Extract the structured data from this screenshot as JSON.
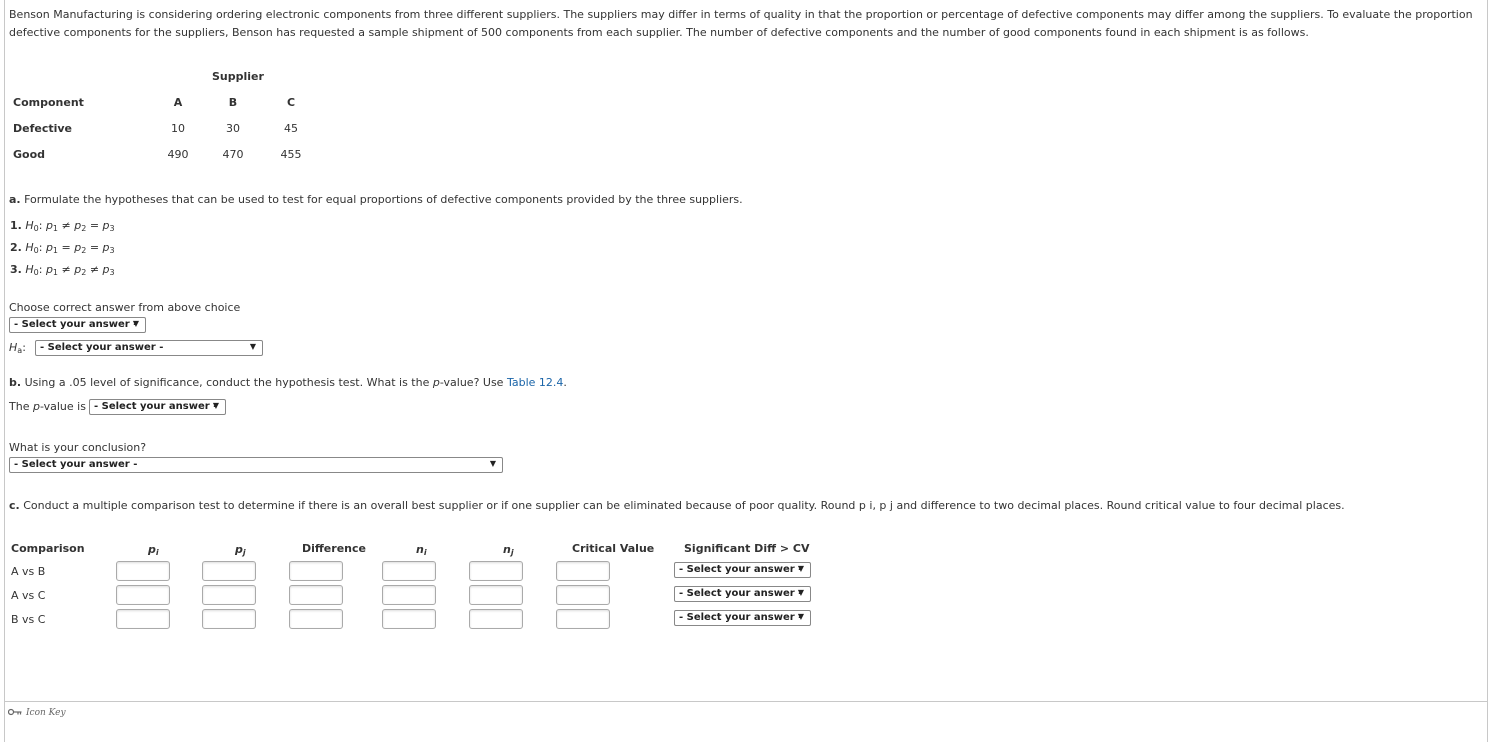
{
  "intro": "Benson Manufacturing is considering ordering electronic components from three different suppliers. The suppliers may differ in terms of quality in that the proportion or percentage of defective components may differ among the suppliers. To evaluate the proportion defective components for the suppliers, Benson has requested a sample shipment of 500 components from each supplier. The number of defective components and the number of good components found in each shipment is as follows.",
  "data_table": {
    "group_header": "Supplier",
    "row_header": "Component",
    "columns": [
      "A",
      "B",
      "C"
    ],
    "rows": [
      {
        "label": "Defective",
        "values": [
          "10",
          "30",
          "45"
        ]
      },
      {
        "label": "Good",
        "values": [
          "490",
          "470",
          "455"
        ]
      }
    ]
  },
  "part_a": {
    "letter": "a.",
    "text": "Formulate the hypotheses that can be used to test for equal proportions of defective components provided by the three suppliers.",
    "choices": [
      {
        "num": "1.",
        "h": "H",
        "h_sub": "0",
        "expr": [
          ":",
          "p",
          "1",
          "≠",
          "p",
          "2",
          "=",
          "p",
          "3"
        ]
      },
      {
        "num": "2.",
        "h": "H",
        "h_sub": "0",
        "expr": [
          ":",
          "p",
          "1",
          "=",
          "p",
          "2",
          "=",
          "p",
          "3"
        ]
      },
      {
        "num": "3.",
        "h": "H",
        "h_sub": "0",
        "expr": [
          ":",
          "p",
          "1",
          "≠",
          "p",
          "2",
          "≠",
          "p",
          "3"
        ]
      }
    ],
    "choose_label": "Choose correct answer from above choice",
    "select_placeholder": "- Select your answer -",
    "ha_label": "H",
    "ha_sub": "a",
    "ha_colon": ":",
    "ha_select": "- Select your answer -"
  },
  "part_b": {
    "letter": "b.",
    "text_pre": "Using a .05 level of significance, conduct the hypothesis test. What is the ",
    "text_p": "p",
    "text_post": "-value? Use ",
    "link": "Table 12.4",
    "period": ".",
    "pvalue_pre": "The ",
    "pvalue_p": "p",
    "pvalue_post": "-value is",
    "pvalue_select": "- Select your answer -",
    "conclusion_label": "What is your conclusion?",
    "conclusion_select": "- Select your answer -"
  },
  "part_c": {
    "letter": "c.",
    "text": "Conduct a multiple comparison test to determine if there is an overall best supplier or if one supplier can be eliminated because of poor quality. Round p i, p j and difference to two decimal places. Round critical value to four decimal places.",
    "headers": {
      "comparison": "Comparison",
      "pi": "p",
      "pi_sub": "i",
      "pj": "p",
      "pj_sub": "j",
      "difference": "Difference",
      "ni": "n",
      "ni_sub": "i",
      "nj": "n",
      "nj_sub": "j",
      "critical": "Critical Value",
      "significant": "Significant Diff > CV"
    },
    "rows": [
      {
        "label": "A vs B",
        "select": "- Select your answer -"
      },
      {
        "label": "A vs C",
        "select": "- Select your answer -"
      },
      {
        "label": "B vs C",
        "select": "- Select your answer -"
      }
    ]
  },
  "footer": {
    "icon_key": "Icon Key"
  }
}
